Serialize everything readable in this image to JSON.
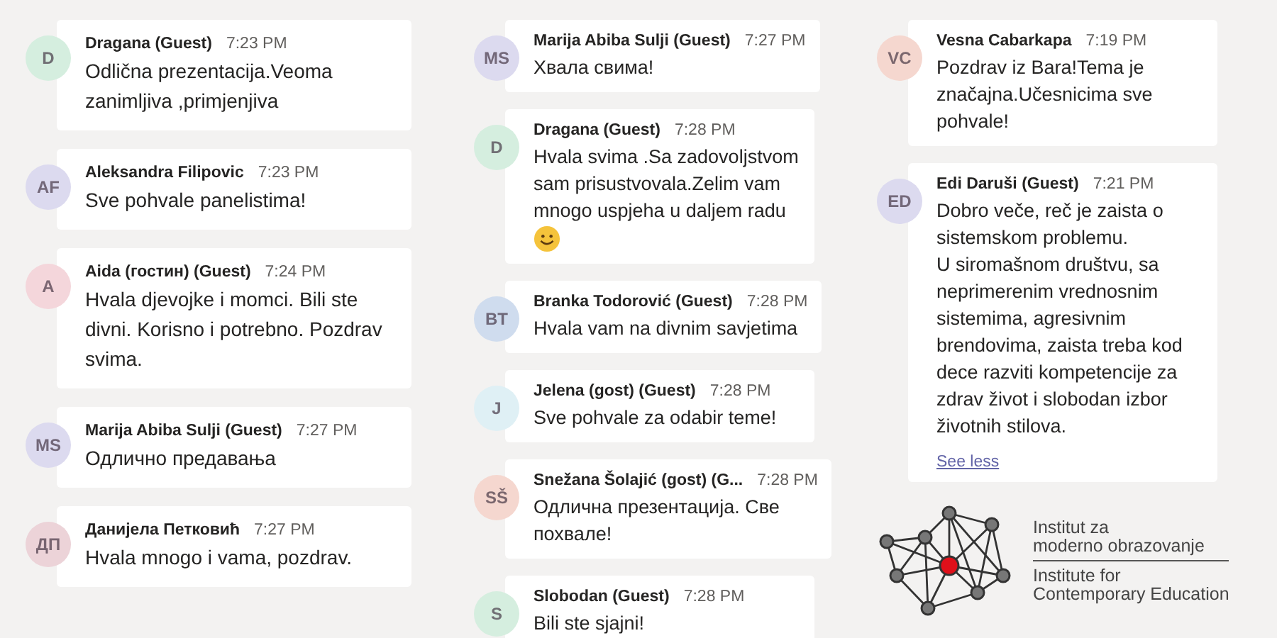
{
  "columns": [
    {
      "messages": [
        {
          "initials": "D",
          "color": "#d5eedf",
          "author": "Dragana (Guest)",
          "time": "7:23 PM",
          "text": "Odlična prezentacija.Veoma zanimljiva ,primjenjiva",
          "emoji": false
        },
        {
          "initials": "AF",
          "color": "#dcdaef",
          "author": "Aleksandra Filipovic",
          "time": "7:23 PM",
          "text": "Sve pohvale panelistima!",
          "emoji": false
        },
        {
          "initials": "A",
          "color": "#f4d6db",
          "author": "Aida (гостин) (Guest)",
          "time": "7:24 PM",
          "text": "Hvala djevojke i momci. Bili ste divni. Korisno i potrebno. Pozdrav svima.",
          "emoji": false
        },
        {
          "initials": "MS",
          "color": "#dcdaef",
          "author": "Marija Abiba Sulji (Guest)",
          "time": "7:27 PM",
          "text": "Одлично предавања",
          "emoji": false
        },
        {
          "initials": "ДП",
          "color": "#ecd3d8",
          "author": "Данијела Петковић",
          "time": "7:27 PM",
          "text": "Hvala mnogo i vama, pozdrav.",
          "emoji": false
        }
      ]
    },
    {
      "messages": [
        {
          "initials": "MS",
          "color": "#dcdaef",
          "author": "Marija Abiba Sulji (Guest)",
          "time": "7:27 PM",
          "text": "Хвала свима!",
          "emoji": false
        },
        {
          "initials": "D",
          "color": "#d5eedf",
          "author": "Dragana (Guest)",
          "time": "7:28 PM",
          "text": "Hvala svima .Sa zadovoljstvom sam prisustvovala.Zelim vam mnogo uspjeha u daljem radu",
          "emoji": true
        },
        {
          "initials": "BT",
          "color": "#cfdcee",
          "author": "Branka Todorović (Guest)",
          "time": "7:28 PM",
          "text": "Hvala vam  na divnim savjetima",
          "emoji": false
        },
        {
          "initials": "J",
          "color": "#dff0f5",
          "author": "Jelena (gost) (Guest)",
          "time": "7:28 PM",
          "text": "Sve  pohvale za odabir teme!",
          "emoji": false
        },
        {
          "initials": "SŠ",
          "color": "#f5d7cf",
          "author": "Snežana Šolajić (gost) (G...",
          "time": "7:28 PM",
          "text": "Одлична презентација. Све похвале!",
          "emoji": false
        },
        {
          "initials": "S",
          "color": "#d5eedf",
          "author": "Slobodan (Guest)",
          "time": "7:28 PM",
          "text": "Bili ste sjajni!",
          "emoji": false
        }
      ]
    },
    {
      "messages": [
        {
          "initials": "VC",
          "color": "#f5d7cf",
          "author": "Vesna Cabarkapa",
          "time": "7:19 PM",
          "text": "Pozdrav iz Bara!Tema je značajna.Učesnicima sve pohvale!",
          "emoji": false
        },
        {
          "initials": "ED",
          "color": "#dcdaef",
          "author": "Edi Daruši (Guest)",
          "time": "7:21 PM",
          "text": "Dobro veče, reč je zaista o sistemskom problemu.\nU siromašnom društvu, sa neprimerenim vrednosnim sistemima, agresivnim brendovima, zaista treba kod dece razviti kompetencije za zdrav život i slobodan izbor životnih stilova.",
          "emoji": false,
          "link": "See less"
        }
      ]
    }
  ],
  "logo": {
    "top_lines": [
      "Institut za",
      "moderno obrazovanje"
    ],
    "bottom_lines": [
      "Institute for",
      "Contemporary Education"
    ]
  }
}
